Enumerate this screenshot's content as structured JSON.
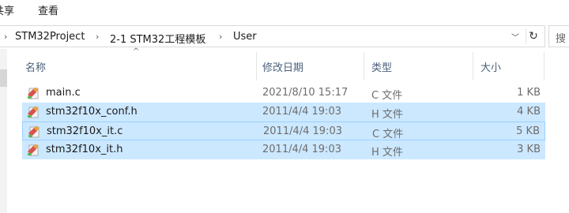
{
  "ribbon": {
    "tabs": [
      "共享",
      "查看"
    ]
  },
  "address": {
    "breadcrumbs": [
      "STM32Project",
      "2-1 STM32工程模板",
      "User"
    ],
    "separator": "›",
    "dropdown_glyph": "﹀",
    "refresh_glyph": "↻",
    "search_placeholder": "搜"
  },
  "columns": {
    "sort_glyph": "^",
    "name": "名称",
    "date": "修改日期",
    "type": "类型",
    "size": "大小"
  },
  "files": [
    {
      "name": "main.c",
      "date": "2021/8/10 15:17",
      "type": "C 文件",
      "size": "1 KB",
      "selected": false
    },
    {
      "name": "stm32f10x_conf.h",
      "date": "2011/4/4 19:03",
      "type": "H 文件",
      "size": "4 KB",
      "selected": true
    },
    {
      "name": "stm32f10x_it.c",
      "date": "2011/4/4 19:03",
      "type": "C 文件",
      "size": "5 KB",
      "selected": true
    },
    {
      "name": "stm32f10x_it.h",
      "date": "2011/4/4 19:03",
      "type": "H 文件",
      "size": "3 KB",
      "selected": true
    }
  ],
  "colors": {
    "selection": "#cce8ff",
    "focus_border": "#99d1ff",
    "header_text": "#4c607a"
  },
  "icons": {
    "file": "code-file-icon",
    "refresh": "refresh-icon",
    "dropdown": "chevron-down-icon"
  }
}
